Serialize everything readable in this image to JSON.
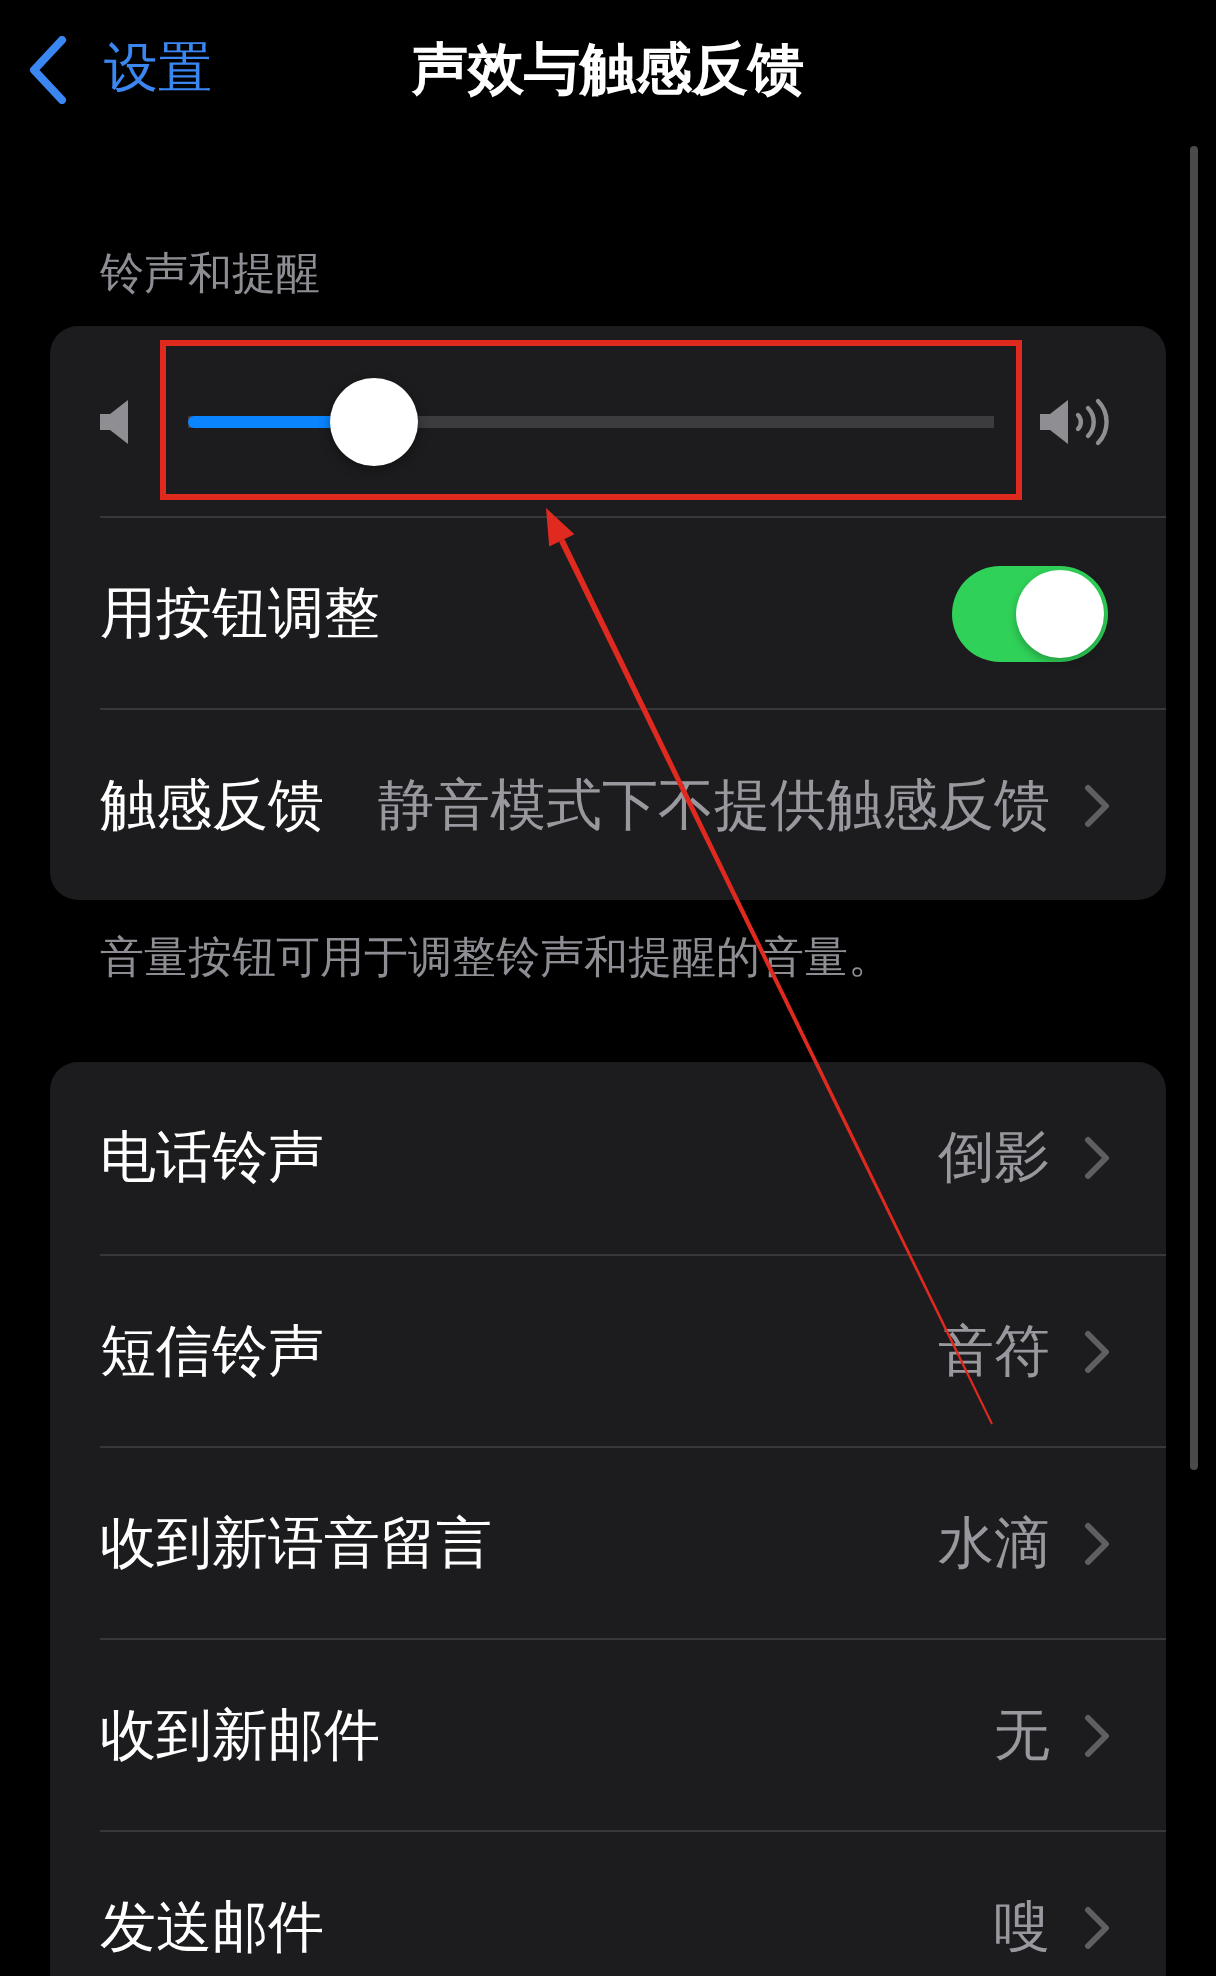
{
  "nav": {
    "back_label": "设置",
    "title": "声效与触感反馈"
  },
  "ringer": {
    "header": "铃声和提醒",
    "volume": {
      "level": 0.23
    },
    "rows": [
      {
        "kind": "toggle",
        "label": "用按钮调整",
        "on": true
      },
      {
        "kind": "link",
        "label": "触感反馈",
        "value": "静音模式下不提供触感反馈"
      }
    ],
    "footer": "音量按钮可用于调整铃声和提醒的音量。"
  },
  "sounds": [
    {
      "label": "电话铃声",
      "value": "倒影"
    },
    {
      "label": "短信铃声",
      "value": "音符"
    },
    {
      "label": "收到新语音留言",
      "value": "水滴"
    },
    {
      "label": "收到新邮件",
      "value": "无"
    },
    {
      "label": "发送邮件",
      "value": "嗖"
    }
  ],
  "annotation": {
    "kind": "highlight_box",
    "arrow": true
  }
}
